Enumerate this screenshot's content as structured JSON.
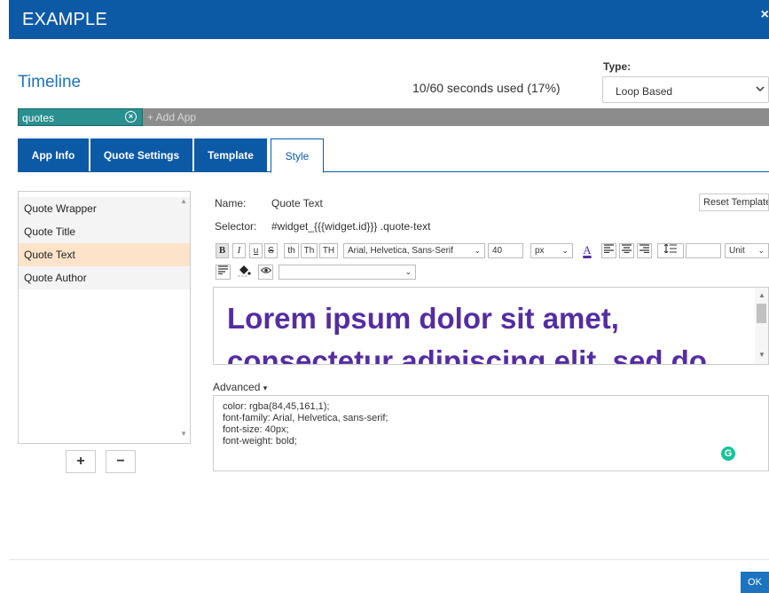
{
  "dialog": {
    "title": "EXAMPLE",
    "close_glyph": "×"
  },
  "timeline": {
    "title": "Timeline",
    "usage": "10/60 seconds used (17%)"
  },
  "type": {
    "label": "Type:",
    "selected": "Loop Based"
  },
  "apps": {
    "chip_label": "quotes",
    "add_label": "+ Add App"
  },
  "tabs": [
    {
      "label": "App Info",
      "active": false
    },
    {
      "label": "Quote Settings",
      "active": false
    },
    {
      "label": "Template",
      "active": false
    },
    {
      "label": "Style",
      "active": true
    }
  ],
  "style_list": {
    "items": [
      "Quote Wrapper",
      "Quote Title",
      "Quote Text",
      "Quote Author"
    ],
    "selected": "Quote Text",
    "add_label": "+",
    "remove_label": "−"
  },
  "editor": {
    "name_label": "Name:",
    "name_value": "Quote Text",
    "reset_label": "Reset Template",
    "selector_label": "Selector:",
    "selector_value": "#widget_{{{widget.id}}} .quote-text",
    "toolbar": {
      "bold": "B",
      "italic": "I",
      "underline": "u",
      "strike": "S",
      "th1": "th",
      "th2": "Th",
      "th3": "TH",
      "font_family": "Arial, Helvetica, Sans-Serif",
      "font_size": "40",
      "font_unit": "px",
      "line_height_unit": "Unit",
      "font_color": "#542da1"
    },
    "preview_line1": "Lorem ipsum dolor sit amet,",
    "preview_line2": "consectetur adipiscing elit, sed do",
    "advanced_label": "Advanced",
    "advanced_css": [
      "color: rgba(84,45,161,1);",
      "font-family: Arial, Helvetica, sans-serif;",
      "font-size: 40px;",
      "font-weight: bold;"
    ]
  },
  "footer": {
    "ok_label": "OK"
  },
  "colors": {
    "primary": "#0c5aa6",
    "accent": "#1e73be",
    "chip": "#2a8f8f",
    "selected_row": "#fce3c9",
    "preview_text": "#542da1"
  }
}
